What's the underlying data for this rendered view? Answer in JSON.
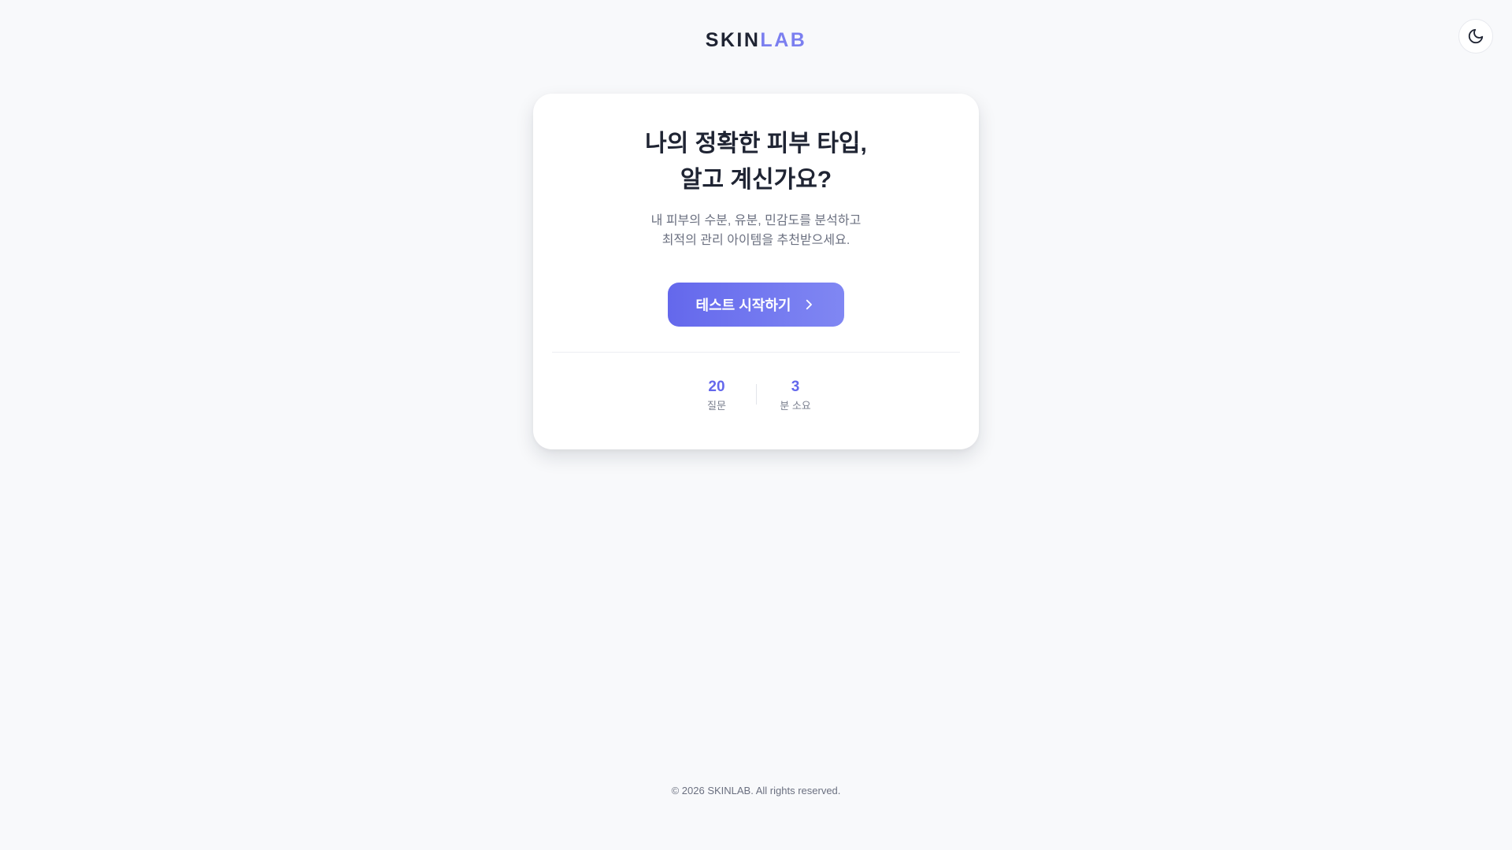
{
  "header": {
    "logo_part1": "SKIN",
    "logo_part2": "LAB",
    "theme_toggle_icon": "moon-icon"
  },
  "hero": {
    "title_line1": "나의 정확한 피부 타입,",
    "title_line2": "알고 계신가요?",
    "subtitle_line1": "내 피부의 수분, 유분, 민감도를 분석하고",
    "subtitle_line2": "최적의 관리 아이템을 추천받으세요.",
    "start_button_label": "테스트 시작하기",
    "start_button_icon": "chevron-right-icon"
  },
  "stats": [
    {
      "value": "20",
      "label": "질문"
    },
    {
      "value": "3",
      "label": "분 소요"
    }
  ],
  "footer": {
    "copyright": "© 2026 SKINLAB. All rights reserved."
  },
  "colors": {
    "accent": "#6468ec",
    "accent_light": "#7b7ff0",
    "background": "#f8f9fb",
    "card": "#ffffff",
    "text_primary": "#1f2433",
    "text_muted": "#6b7080"
  }
}
